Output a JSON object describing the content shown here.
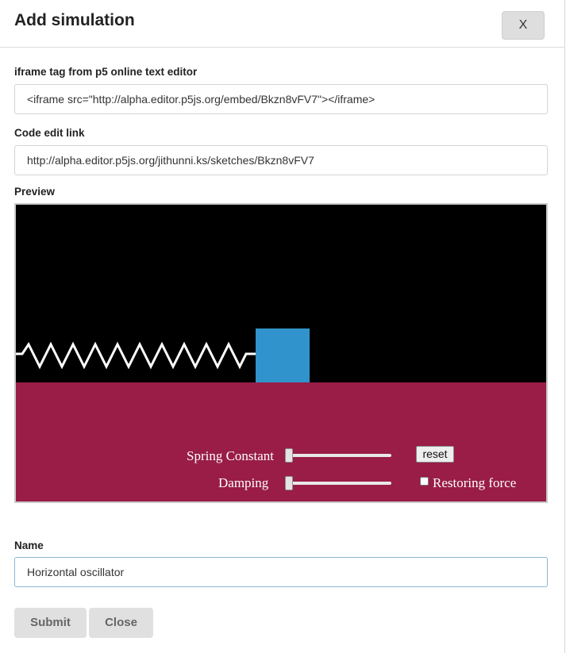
{
  "modal": {
    "title": "Add simulation",
    "close_label": "X"
  },
  "form": {
    "iframe_label": "iframe tag from p5 online text editor",
    "iframe_value": "<iframe src=\"http://alpha.editor.p5js.org/embed/Bkzn8vFV7\"></iframe>",
    "code_link_label": "Code edit link",
    "code_link_value": "http://alpha.editor.p5js.org/jithunni.ks/sketches/Bkzn8vFV7",
    "preview_label": "Preview",
    "name_label": "Name",
    "name_value": "Horizontal oscillator"
  },
  "preview": {
    "spring_constant_label": "Spring Constant",
    "damping_label": "Damping",
    "reset_label": "reset",
    "restoring_force_label": "Restoring force",
    "restoring_force_checked": false,
    "spring_constant_level": 0,
    "damping_level": 0,
    "colors": {
      "sky": "#000000",
      "ground": "#991d46",
      "block": "#3193cb",
      "spring": "#ffffff"
    }
  },
  "footer": {
    "submit_label": "Submit",
    "close_label": "Close"
  }
}
